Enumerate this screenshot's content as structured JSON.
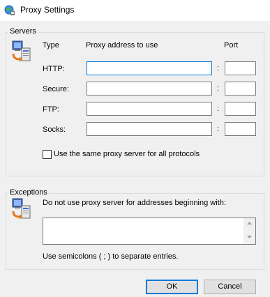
{
  "window": {
    "title": "Proxy Settings",
    "app_icon": "globe-network-icon"
  },
  "servers": {
    "legend": "Servers",
    "icon": "network-computer-icon",
    "col_type": "Type",
    "col_address": "Proxy address to use",
    "col_port": "Port",
    "rows": [
      {
        "label": "HTTP:",
        "address": "",
        "port": ""
      },
      {
        "label": "Secure:",
        "address": "",
        "port": ""
      },
      {
        "label": "FTP:",
        "address": "",
        "port": ""
      },
      {
        "label": "Socks:",
        "address": "",
        "port": ""
      }
    ],
    "colon": ":",
    "same_proxy_label": "Use the same proxy server for all protocols",
    "same_proxy_checked": false
  },
  "exceptions": {
    "legend": "Exceptions",
    "icon": "network-computer-icon",
    "description": "Do not use proxy server for addresses beginning with:",
    "value": "",
    "hint": "Use semicolons ( ; ) to separate entries."
  },
  "buttons": {
    "ok": "OK",
    "cancel": "Cancel"
  },
  "colors": {
    "focus_border": "#0078d7",
    "window_bg": "#f0f0f0"
  }
}
